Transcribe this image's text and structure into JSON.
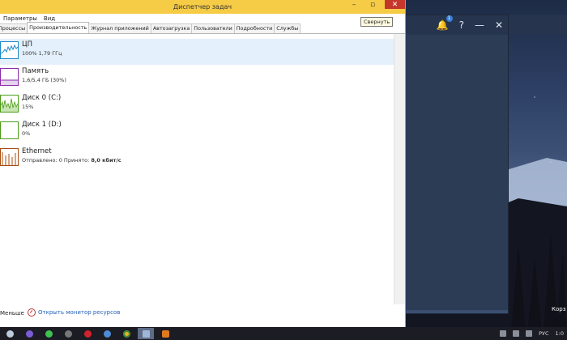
{
  "window": {
    "title": "Диспетчер задач",
    "tooltip": "Свернуть"
  },
  "menu": [
    "Параметры",
    "Вид"
  ],
  "tabs": [
    {
      "label": "Процессы",
      "active": false
    },
    {
      "label": "Производительность",
      "active": true
    },
    {
      "label": "Журнал приложений",
      "active": false
    },
    {
      "label": "Автозагрузка",
      "active": false
    },
    {
      "label": "Пользователи",
      "active": false
    },
    {
      "label": "Подробности",
      "active": false
    },
    {
      "label": "Службы",
      "active": false
    }
  ],
  "resources": [
    {
      "name": "ЦП",
      "value": "100% 1,79 ГГц",
      "color": "#1a86c8",
      "selected": true
    },
    {
      "name": "Память",
      "value": "1,6/5,4 ГБ (30%)",
      "color": "#8b2aa9",
      "selected": false
    },
    {
      "name": "Диск 0 (C:)",
      "value": "15%",
      "color": "#4c9b18",
      "selected": false
    },
    {
      "name": "Диск 1 (D:)",
      "value": "0%",
      "color": "#4c9b18",
      "selected": false
    },
    {
      "name": "Ethernet",
      "value_prefix": "Отправлено: 0 Принято:",
      "value_bold": "8,0 кбит/с",
      "color": "#a84d10",
      "selected": false
    }
  ],
  "footer": {
    "fewer_details": "Меньше",
    "open_monitor": "Открыть монитор ресурсов"
  },
  "background_app": {
    "notification_count": "1",
    "help_symbol": "?",
    "side_label": "Корз"
  },
  "taskbar": {
    "language": "РУС",
    "clock": "1:0",
    "items": [
      "search-icon",
      "cortana-icon",
      "whatsapp-icon",
      "media-icon",
      "recorder-icon",
      "browser-icon",
      "chrome-icon",
      "task-manager-icon",
      "app-icon"
    ],
    "colors": {
      "accent": "#f6cb46",
      "close": "#c6372b",
      "taskbar": "#1c1c24"
    }
  }
}
